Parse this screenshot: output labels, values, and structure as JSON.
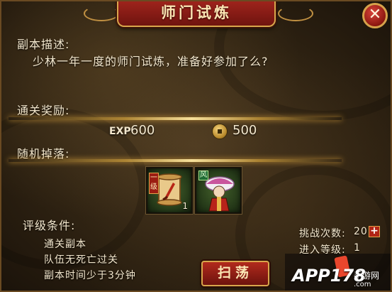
{
  "dialog": {
    "title": "师门试炼",
    "close_symbol": "✕"
  },
  "description": {
    "label": "副本描述:",
    "text": "少林一年一度的师门试炼，准备好参加了么?"
  },
  "rewards": {
    "label": "通关奖励:",
    "exp_tag": "EXP",
    "exp_value": "600",
    "coin_value": "500"
  },
  "drops": {
    "label": "随机掉落:",
    "items": [
      {
        "icon": "scroll-icon",
        "badge": "一级",
        "quantity": "1"
      },
      {
        "icon": "hero-portrait-icon",
        "badge": "风",
        "quantity": ""
      }
    ]
  },
  "conditions": {
    "label": "评级条件:",
    "list": [
      "通关副本",
      "队伍无死亡过关",
      "副本时间少于3分钟"
    ]
  },
  "stats": {
    "challenge_label": "挑战次数:",
    "challenge_value": "20",
    "level_label": "进入等级:",
    "level_value": "1",
    "plus_symbol": "+"
  },
  "actions": {
    "sweep_label": "扫荡"
  },
  "watermark": {
    "brand": "APP178",
    "sub": "手游网",
    "url": ".com"
  },
  "colors": {
    "panel": "#2e2212",
    "accent_red": "#9b1d12",
    "gold_border": "#d8a64c",
    "text": "#f3e7cd"
  }
}
